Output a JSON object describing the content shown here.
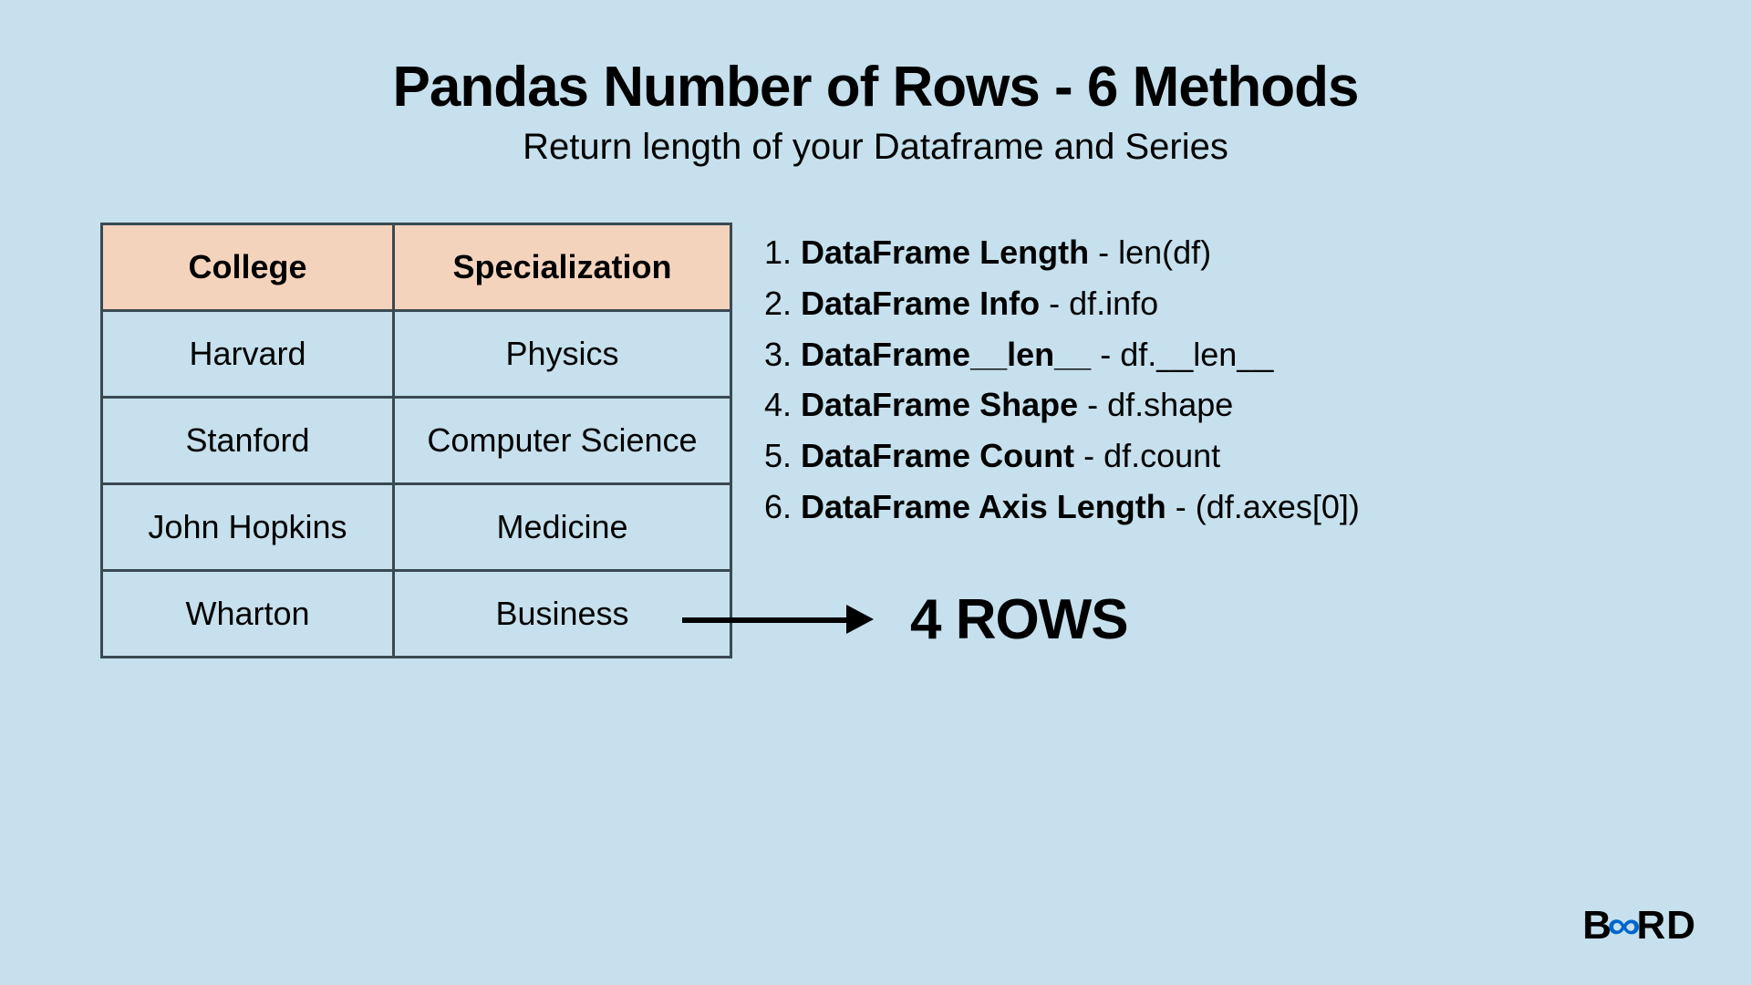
{
  "header": {
    "title": "Pandas Number of Rows - 6 Methods",
    "subtitle": "Return length of your Dataframe and Series"
  },
  "table": {
    "headers": [
      "College",
      "Specialization"
    ],
    "rows": [
      [
        "Harvard",
        "Physics"
      ],
      [
        "Stanford",
        "Computer Science"
      ],
      [
        "John Hopkins",
        "Medicine"
      ],
      [
        "Wharton",
        "Business"
      ]
    ]
  },
  "methods": [
    {
      "name": "DataFrame Length",
      "code": "len(df)"
    },
    {
      "name": "DataFrame Info",
      "code": "df.info"
    },
    {
      "name": "DataFrame__len__",
      "code": "df.__len__"
    },
    {
      "name": "DataFrame Shape",
      "code": "df.shape"
    },
    {
      "name": "DataFrame Count",
      "code": "df.count"
    },
    {
      "name": "DataFrame Axis Length",
      "code": "(df.axes[0])"
    }
  ],
  "result": "4 ROWS",
  "logo": {
    "part1": "B",
    "part2": "∞",
    "part3": "RD"
  }
}
